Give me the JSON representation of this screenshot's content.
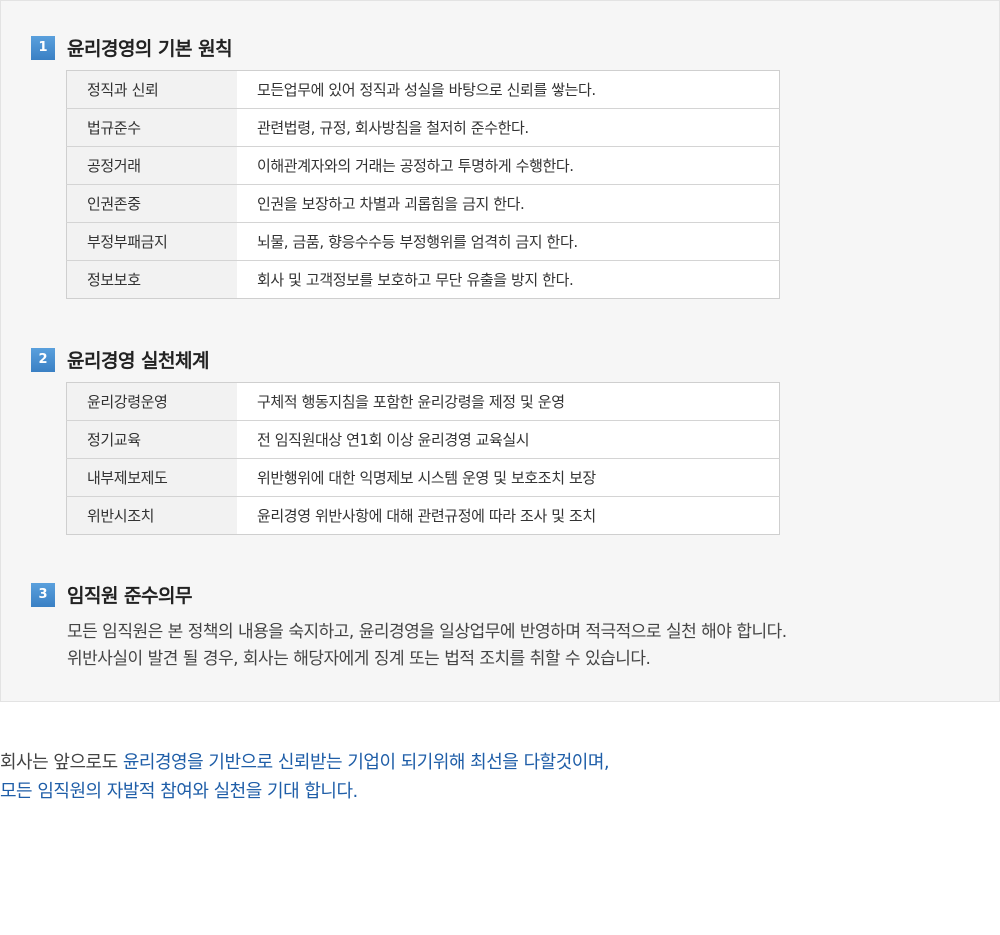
{
  "sections": [
    {
      "num": "1",
      "title": "윤리경영의 기본 원칙",
      "rows": [
        {
          "key": "정직과 신뢰",
          "value": "모든업무에 있어 정직과 성실을 바탕으로 신뢰를 쌓는다."
        },
        {
          "key": "법규준수",
          "value": "관련법령, 규정, 회사방침을 철저히 준수한다."
        },
        {
          "key": "공정거래",
          "value": "이해관계자와의 거래는 공정하고 투명하게 수행한다."
        },
        {
          "key": "인권존중",
          "value": "인권을 보장하고 차별과 괴롭힘을 금지 한다."
        },
        {
          "key": "부정부패금지",
          "value": "뇌물, 금품, 향응수수등 부정행위를 엄격히 금지 한다."
        },
        {
          "key": "정보보호",
          "value": "회사 및 고객정보를 보호하고 무단 유출을 방지 한다."
        }
      ]
    },
    {
      "num": "2",
      "title": "윤리경영 실천체계",
      "rows": [
        {
          "key": "윤리강령운영",
          "value": "구체적 행동지침을 포함한 윤리강령을 제정 및 운영"
        },
        {
          "key": "정기교육",
          "value": "전 임직원대상 연1회 이상 윤리경영 교육실시"
        },
        {
          "key": "내부제보제도",
          "value": "위반행위에 대한 익명제보 시스템 운영 및 보호조치 보장"
        },
        {
          "key": "위반시조치",
          "value": "윤리경영 위반사항에 대해 관련규정에 따라 조사 및 조치"
        }
      ]
    },
    {
      "num": "3",
      "title": "임직원 준수의무",
      "lines": [
        "모든 임직원은 본 정책의 내용을 숙지하고, 윤리경영을 일상업무에 반영하며 적극적으로 실천 해야 합니다.",
        "위반사실이 발견 될 경우, 회사는 해당자에게 징계 또는 법적 조치를 취할 수 있습니다."
      ]
    }
  ],
  "closing": {
    "line1_prefix": "회사는 앞으로도 ",
    "line1_highlight": "윤리경영을 기반으로 신뢰받는 기업이 되기위해 최선을 다할것이며,",
    "line2_highlight": "모든 임직원의 자발적 참여와 실천을 기대 합니다."
  },
  "colors": {
    "accent": "#3a80c4",
    "highlight_text": "#1f5ea8",
    "panel_bg": "#f6f6f6"
  }
}
